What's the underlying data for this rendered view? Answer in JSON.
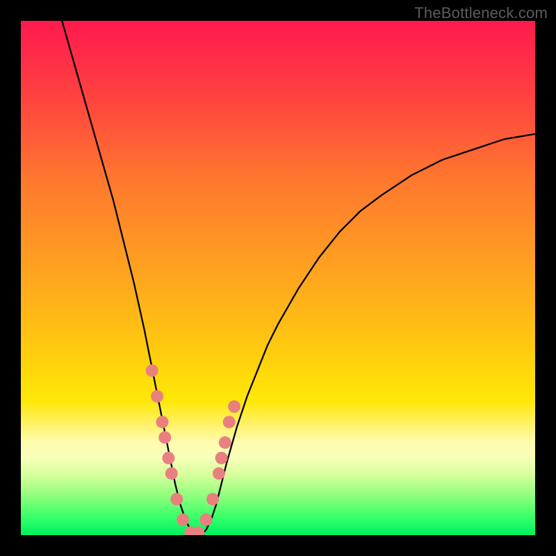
{
  "watermark": "TheBottleneck.com",
  "colors": {
    "frame_bg": "#000000",
    "curve_stroke": "#000000",
    "marker_fill": "#e98080",
    "marker_stroke": "#cc6a6a",
    "gradient_top": "#ff1a4d",
    "gradient_bottom": "#00f060"
  },
  "chart_data": {
    "type": "line",
    "title": "",
    "xlabel": "",
    "ylabel": "",
    "xlim": [
      0,
      100
    ],
    "ylim": [
      0,
      100
    ],
    "grid": false,
    "note": "Axes unlabeled in source; x/y are normalized 0-100. Curve is a V-shaped bottleneck profile descending from top-left to a floor near x≈33 then rising to the right. Marker points trace the lower portion of both arms and the floor.",
    "series": [
      {
        "name": "bottleneck-curve",
        "x": [
          8,
          10,
          12,
          14,
          16,
          18,
          20,
          22,
          24,
          25,
          26,
          27,
          28,
          29,
          30,
          31,
          32,
          33,
          34,
          35,
          36,
          37,
          38,
          39,
          40,
          42,
          44,
          46,
          48,
          50,
          54,
          58,
          62,
          66,
          70,
          76,
          82,
          88,
          94,
          100
        ],
        "y": [
          100,
          93,
          86,
          79,
          72,
          65,
          57,
          49,
          40,
          35,
          30,
          25,
          20,
          15,
          10,
          6,
          3,
          1,
          0,
          0,
          1,
          3,
          6,
          10,
          14,
          21,
          27,
          32,
          37,
          41,
          48,
          54,
          59,
          63,
          66,
          70,
          73,
          75,
          77,
          78
        ]
      },
      {
        "name": "curve-markers",
        "x": [
          25.5,
          26.5,
          27.5,
          28.0,
          28.7,
          29.3,
          30.3,
          31.5,
          33.0,
          34.5,
          36.0,
          37.3,
          38.5,
          39.0,
          39.7,
          40.5,
          41.5
        ],
        "y": [
          32,
          27,
          22,
          19,
          15,
          12,
          7,
          3,
          0.5,
          0.5,
          3,
          7,
          12,
          15,
          18,
          22,
          25
        ]
      }
    ]
  }
}
